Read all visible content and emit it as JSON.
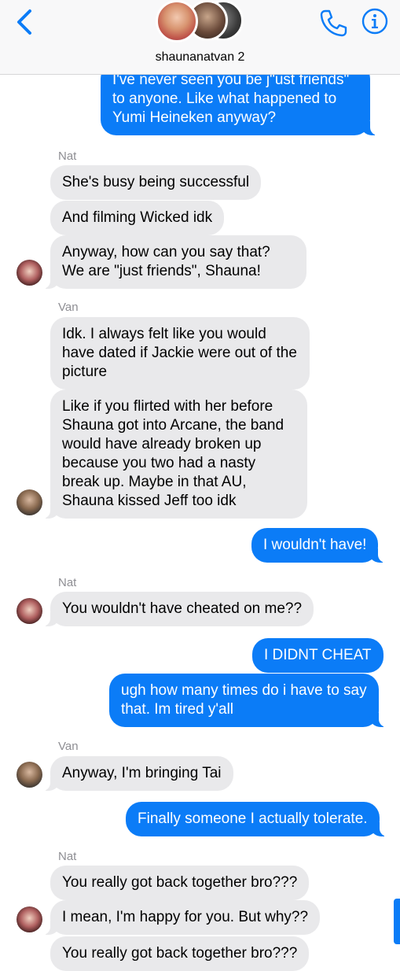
{
  "header": {
    "group_name": "shaunanatvan 2"
  },
  "senders": {
    "nat_1": "Nat",
    "van_1": "Van",
    "nat_2": "Nat",
    "van_2": "Van",
    "nat_3": "Nat"
  },
  "messages": {
    "m1": "I've never seen you be j\"ust friends\" to anyone. Like what happened to Yumi Heineken anyway?",
    "m2": "She's busy being successful",
    "m3": "And filming Wicked idk",
    "m4": "Anyway, how can you say that? We are \"just friends\", Shauna!",
    "m5": "Idk. I always felt like you would have dated if Jackie were out of the picture",
    "m6": "Like if you flirted with her before Shauna got into Arcane, the band would have already broken up because you two had a nasty break up. Maybe in that AU, Shauna kissed Jeff too idk",
    "m7": "I wouldn't have!",
    "m8": "You wouldn't have cheated on me??",
    "m9": "I DIDNT CHEAT",
    "m10": "ugh how many times do i have to say that. Im tired y'all",
    "m11": "Anyway, I'm bringing Tai",
    "m12": "Finally someone I actually tolerate.",
    "m13": "You really got back together bro???",
    "m14": "I mean, I'm happy for you. But why??",
    "m15": "You really got back together bro???"
  },
  "colors": {
    "outgoing_bubble": "#0b7cf7",
    "incoming_bubble": "#e9e9eb",
    "sender_label": "#8e8e93",
    "accent": "#0b7cf7"
  },
  "icons": {
    "back": "chevron-left-icon",
    "call": "phone-icon",
    "info": "info-icon"
  }
}
